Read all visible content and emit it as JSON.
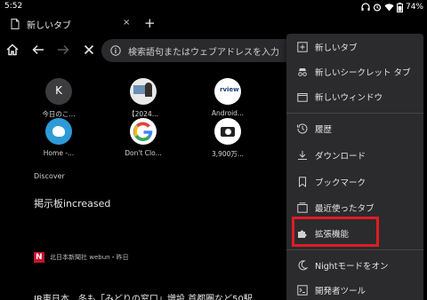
{
  "status_bar": {
    "time": "5:52",
    "battery": "74%"
  },
  "tab": {
    "title": "新しいタブ",
    "close": "×",
    "new_tab": "+"
  },
  "omnibox": {
    "placeholder": "検索語句またはウェブアドレスを入力"
  },
  "shortcuts": [
    {
      "label": "今日のこ...",
      "letter": "K"
    },
    {
      "label": "【2024..."
    },
    {
      "label": "Android...",
      "badge": "rview"
    },
    {
      "label": "Home -..."
    },
    {
      "label": "Don't Clo..."
    },
    {
      "label": "3,900万..."
    }
  ],
  "feed": {
    "section": "Discover",
    "headline": "掲示板increased",
    "source": "北日本新聞社 webun・昨日",
    "headline2": "JR東日本、冬も「みどりの窓口」増設 首都圏など50駅"
  },
  "menu": {
    "items": [
      {
        "label": "新しいタブ",
        "icon": "new-tab-icon"
      },
      {
        "label": "新しいシークレット タブ",
        "icon": "incognito-icon"
      },
      {
        "label": "新しいウィンドウ",
        "icon": "new-window-icon"
      },
      {
        "label": "履歴",
        "icon": "history-icon"
      },
      {
        "label": "ダウンロード",
        "icon": "download-icon"
      },
      {
        "label": "ブックマーク",
        "icon": "bookmark-icon"
      },
      {
        "label": "最近使ったタブ",
        "icon": "recent-tabs-icon"
      },
      {
        "label": "拡張機能",
        "icon": "extensions-icon"
      },
      {
        "label": "Nightモードをオン",
        "icon": "moon-icon"
      },
      {
        "label": "開発者ツール",
        "icon": "devtools-icon"
      }
    ]
  },
  "colors": {
    "highlight": "#e01b24",
    "menu_bg": "#2b2b2e"
  }
}
